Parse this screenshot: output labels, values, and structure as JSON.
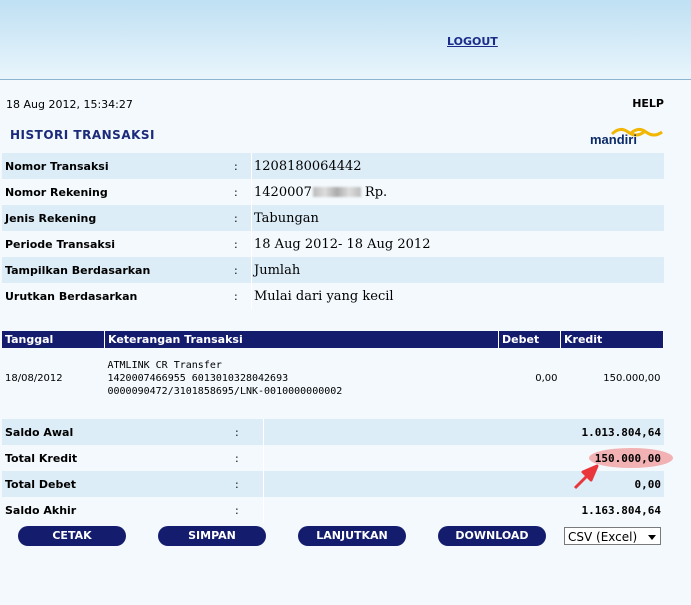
{
  "header": {
    "logout_label": "LOGOUT"
  },
  "page": {
    "datetime": "18 Aug 2012, 15:34:27",
    "help_label": "HELP",
    "title": "HISTORI TRANSAKSI",
    "logo_text": "mandiri"
  },
  "info": {
    "rows": [
      {
        "label": "Nomor Transaksi",
        "sep": ":",
        "value": "1208180064442"
      },
      {
        "label": "Nomor Rekening",
        "sep": ":",
        "value_prefix": "1420007",
        "value_suffix": "Rp."
      },
      {
        "label": "Jenis Rekening",
        "sep": ":",
        "value": "Tabungan"
      },
      {
        "label": "Periode Transaksi",
        "sep": ":",
        "value": "18 Aug 2012- 18 Aug 2012"
      },
      {
        "label": "Tampilkan Berdasarkan",
        "sep": ":",
        "value": "Jumlah"
      },
      {
        "label": "Urutkan Berdasarkan",
        "sep": ":",
        "value": "Mulai dari yang kecil"
      }
    ]
  },
  "transactions": {
    "headers": {
      "date": "Tanggal",
      "desc": "Keterangan Transaksi",
      "debit": "Debet",
      "credit": "Kredit"
    },
    "rows": [
      {
        "date": "18/08/2012",
        "desc_line1": "ATMLINK CR Transfer",
        "desc_line2": "1420007466955 6013010328042693",
        "desc_line3": "0000090472/3101858695/LNK-0010000000002",
        "debit": "0,00",
        "credit": "150.000,00"
      }
    ]
  },
  "summary": {
    "rows": [
      {
        "label": "Saldo Awal",
        "sep": ":",
        "amount": "1.013.804,64"
      },
      {
        "label": "Total Kredit",
        "sep": ":",
        "amount": "150.000,00"
      },
      {
        "label": "Total Debet",
        "sep": ":",
        "amount": "0,00"
      },
      {
        "label": "Saldo Akhir",
        "sep": ":",
        "amount": "1.163.804,64"
      }
    ]
  },
  "actions": {
    "print": "CETAK",
    "save": "SIMPAN",
    "next": "LANJUTKAN",
    "download": "DOWNLOAD",
    "format_selected": "CSV (Excel)"
  },
  "colors": {
    "header_navy": "#141c6e",
    "row_light_blue": "#dcedf7",
    "page_bg": "#f3f9fd",
    "highlight_red": "#e84a4a"
  }
}
